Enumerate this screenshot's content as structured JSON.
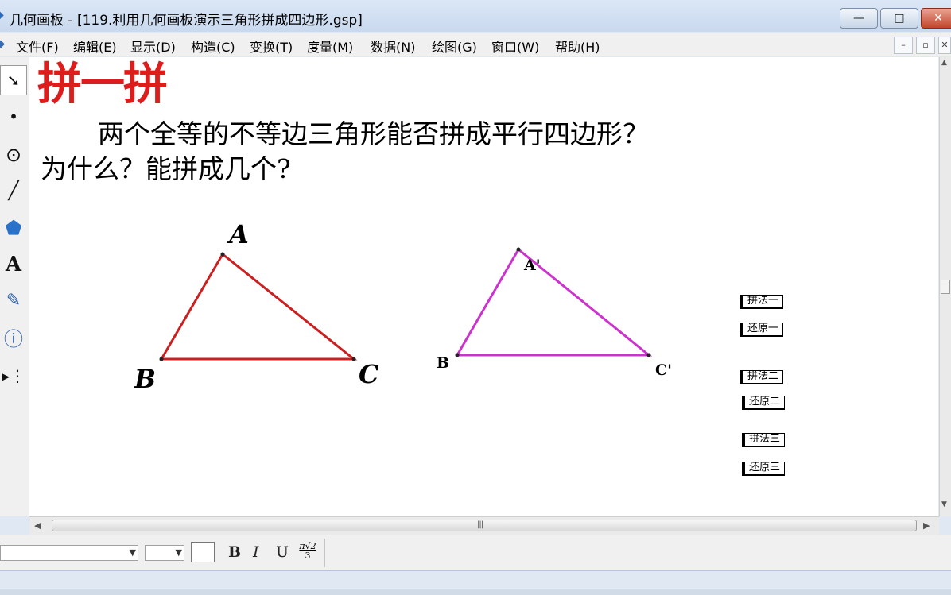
{
  "window": {
    "title": "几何画板 - [119.利用几何画板演示三角形拼成四边形.gsp]",
    "minimize_glyph": "—",
    "maximize_glyph": "□",
    "close_glyph": "✕"
  },
  "menu": [
    "文件(F)",
    "编辑(E)",
    "显示(D)",
    "构造(C)",
    "变换(T)",
    "度量(M)",
    "数据(N)",
    "绘图(G)",
    "窗口(W)",
    "帮助(H)"
  ],
  "doc_controls": [
    "–",
    "▫",
    "✕"
  ],
  "tools": [
    {
      "name": "arrow-tool-icon",
      "glyph": "➘"
    },
    {
      "name": "point-tool-icon",
      "glyph": "•"
    },
    {
      "name": "compass-tool-icon",
      "glyph": "⊙"
    },
    {
      "name": "line-tool-icon",
      "glyph": "╱"
    },
    {
      "name": "polygon-tool-icon",
      "glyph": "⬟"
    },
    {
      "name": "text-tool-icon",
      "glyph": "A"
    },
    {
      "name": "marker-tool-icon",
      "glyph": "✎"
    },
    {
      "name": "info-tool-icon",
      "glyph": "ⓘ"
    },
    {
      "name": "custom-tool-icon",
      "glyph": "▸⋮"
    }
  ],
  "sketch": {
    "heading": "拼一拼",
    "question_line1": "两个全等的不等边三角形能否拼成平行四边形？",
    "question_line2": "为什么？能拼成几个?",
    "triangle1": {
      "labels": [
        "A",
        "B",
        "C"
      ],
      "color": "#cc1f1f"
    },
    "triangle2": {
      "labels": [
        "A'",
        "B",
        "C'"
      ],
      "color": "#cc33cc"
    },
    "buttons": [
      "拼法一",
      "还原一",
      "拼法二",
      "还原二",
      "拼法三",
      "还原三"
    ]
  },
  "textbar": {
    "bold": "B",
    "italic": "I",
    "underline": "U",
    "math_top": "π√2",
    "math_bottom": "3"
  }
}
